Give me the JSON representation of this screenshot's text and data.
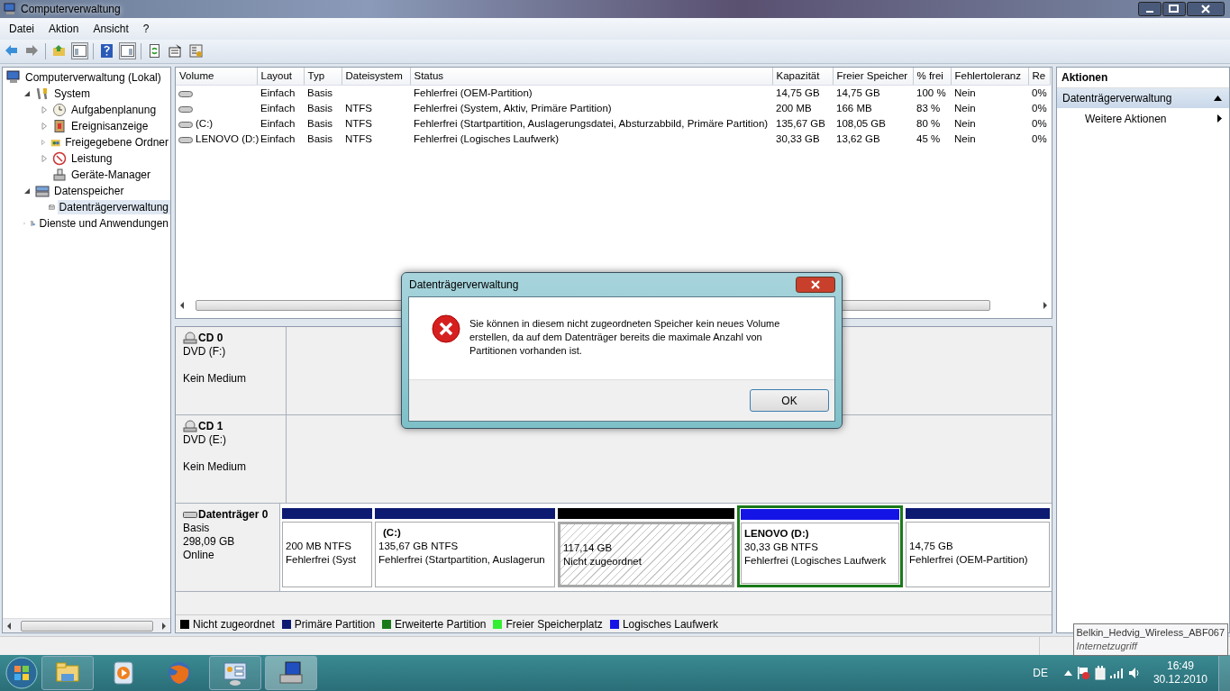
{
  "window": {
    "title": "Computerverwaltung"
  },
  "menu": [
    {
      "label": "Datei"
    },
    {
      "label": "Aktion"
    },
    {
      "label": "Ansicht"
    },
    {
      "label": "?"
    }
  ],
  "tree": [
    {
      "label": "Computerverwaltung (Lokal)",
      "selected": false,
      "children": [
        {
          "label": "System",
          "expanded": true,
          "selected": false,
          "children": [
            {
              "label": "Aufgabenplanung",
              "expanded": false,
              "selected": false
            },
            {
              "label": "Ereignisanzeige",
              "expanded": false,
              "selected": false
            },
            {
              "label": "Freigegebene Ordner",
              "expanded": false,
              "selected": false
            },
            {
              "label": "Leistung",
              "expanded": false,
              "selected": false
            },
            {
              "label": "Geräte-Manager",
              "selected": false
            }
          ]
        },
        {
          "label": "Datenspeicher",
          "expanded": true,
          "selected": false,
          "children": [
            {
              "label": "Datenträgerverwaltung",
              "selected": true
            }
          ]
        },
        {
          "label": "Dienste und Anwendungen",
          "expanded": false,
          "selected": false
        }
      ]
    }
  ],
  "table": {
    "columns": [
      "Volume",
      "Layout",
      "Typ",
      "Dateisystem",
      "Status",
      "Kapazität",
      "Freier Speicher",
      "% frei",
      "Fehlertoleranz",
      "Re"
    ],
    "rows": [
      [
        "",
        "Einfach",
        "Basis",
        "",
        "Fehlerfrei (OEM-Partition)",
        "14,75 GB",
        "14,75 GB",
        "100 %",
        "Nein",
        "0%"
      ],
      [
        "",
        "Einfach",
        "Basis",
        "NTFS",
        "Fehlerfrei (System, Aktiv, Primäre Partition)",
        "200 MB",
        "166 MB",
        "83 %",
        "Nein",
        "0%"
      ],
      [
        "(C:)",
        "Einfach",
        "Basis",
        "NTFS",
        "Fehlerfrei (Startpartition, Auslagerungsdatei, Absturzabbild, Primäre Partition)",
        "135,67 GB",
        "108,05 GB",
        "80 %",
        "Nein",
        "0%"
      ],
      [
        "LENOVO (D:)",
        "Einfach",
        "Basis",
        "NTFS",
        "Fehlerfrei (Logisches Laufwerk)",
        "30,33 GB",
        "13,62 GB",
        "45 %",
        "Nein",
        "0%"
      ]
    ]
  },
  "disks": [
    {
      "kind": "cd",
      "name": "CD 0",
      "type": "DVD (F:)",
      "status": "Kein Medium"
    },
    {
      "kind": "cd",
      "name": "CD 1",
      "type": "DVD (E:)",
      "status": "Kein Medium"
    },
    {
      "kind": "disk",
      "name": "Datenträger 0",
      "type": "Basis",
      "size": "298,09 GB",
      "status": "Online",
      "partitions": [
        {
          "kind": "primary",
          "color": "#0c1a72",
          "selected": false,
          "lines": [
            "200 MB NTFS",
            "Fehlerfrei (Syst"
          ]
        },
        {
          "kind": "primary",
          "color": "#0c1a72",
          "selected": false,
          "name": "(C:)",
          "lines": [
            "135,67 GB NTFS",
            "Fehlerfrei (Startpartition, Auslagerun"
          ]
        },
        {
          "kind": "unallocated",
          "color": "#000000",
          "selected": true,
          "lines": [
            "117,14 GB",
            "Nicht zugeordnet"
          ]
        },
        {
          "kind": "logical",
          "color": "#1414e6",
          "selected": false,
          "name": "LENOVO  (D:)",
          "lines": [
            "30,33 GB NTFS",
            "Fehlerfrei (Logisches Laufwerk"
          ]
        },
        {
          "kind": "primary",
          "color": "#0c1a72",
          "selected": false,
          "lines": [
            "14,75 GB",
            "Fehlerfrei (OEM-Partition)"
          ]
        }
      ]
    }
  ],
  "legend": [
    {
      "label": "Nicht zugeordnet",
      "color": "#000000"
    },
    {
      "label": "Primäre Partition",
      "color": "#0c1a72"
    },
    {
      "label": "Erweiterte Partition",
      "color": "#1a7a1a"
    },
    {
      "label": "Freier Speicherplatz",
      "color": "#33ee33"
    },
    {
      "label": "Logisches Laufwerk",
      "color": "#1414e6"
    }
  ],
  "actions": {
    "title": "Aktionen",
    "section": {
      "label": "Datenträgerverwaltung",
      "expanded": true
    },
    "items": [
      {
        "label": "Weitere Aktionen"
      }
    ]
  },
  "dialog": {
    "title": "Datenträgerverwaltung",
    "message": "Sie können in diesem nicht zugeordneten Speicher kein neues Volume erstellen, da auf dem Datenträger bereits die maximale Anzahl von Partitionen vorhanden ist.",
    "button": "OK"
  },
  "tooltip": {
    "title": "Belkin_Hedvig_Wireless_ABF067",
    "subtitle": "Internetzugriff"
  },
  "taskbar": {
    "buttons": [
      {
        "running": true,
        "selected": false
      },
      {
        "running": false,
        "selected": false
      },
      {
        "running": false,
        "selected": false
      },
      {
        "running": true,
        "selected": false
      },
      {
        "running": true,
        "selected": true
      }
    ],
    "language": "DE",
    "time": "16:49",
    "date": "30.12.2010"
  }
}
